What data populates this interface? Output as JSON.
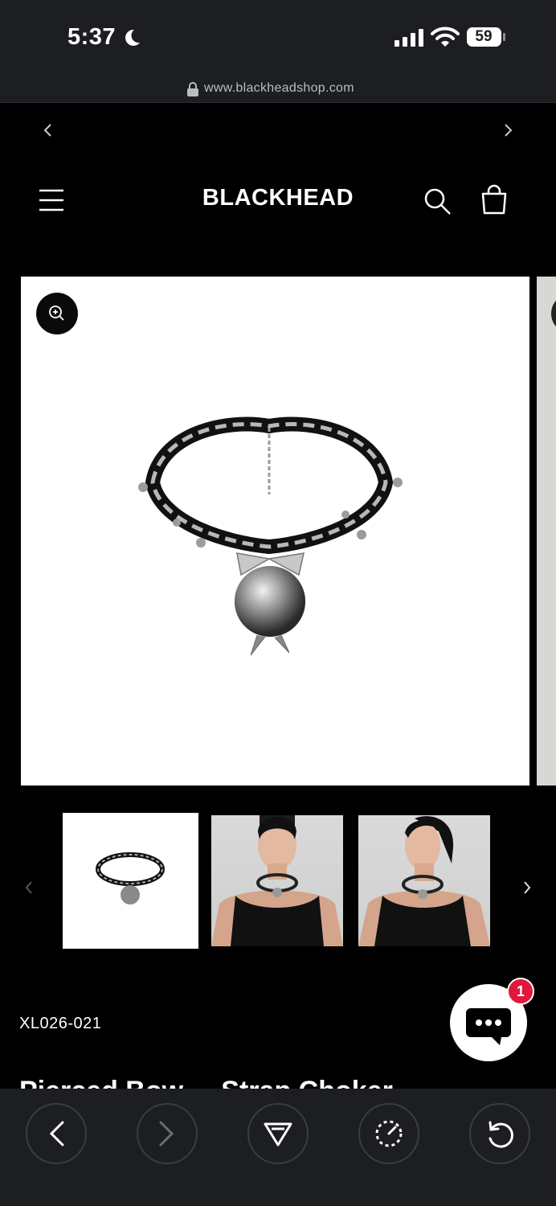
{
  "status_bar": {
    "time": "5:37",
    "battery": "59"
  },
  "browser": {
    "url": "www.blackheadshop.com"
  },
  "header": {
    "logo": "BLACKHEAD"
  },
  "product": {
    "sku": "XL026-021",
    "title": "Pierced Bow ... Strap Choker",
    "thumbnails": [
      "Product image",
      "Model front",
      "Model side"
    ]
  },
  "chat": {
    "badge": "1"
  },
  "colors": {
    "background": "#000000",
    "toolbar": "#1c1e22",
    "badge": "#e0183a"
  }
}
